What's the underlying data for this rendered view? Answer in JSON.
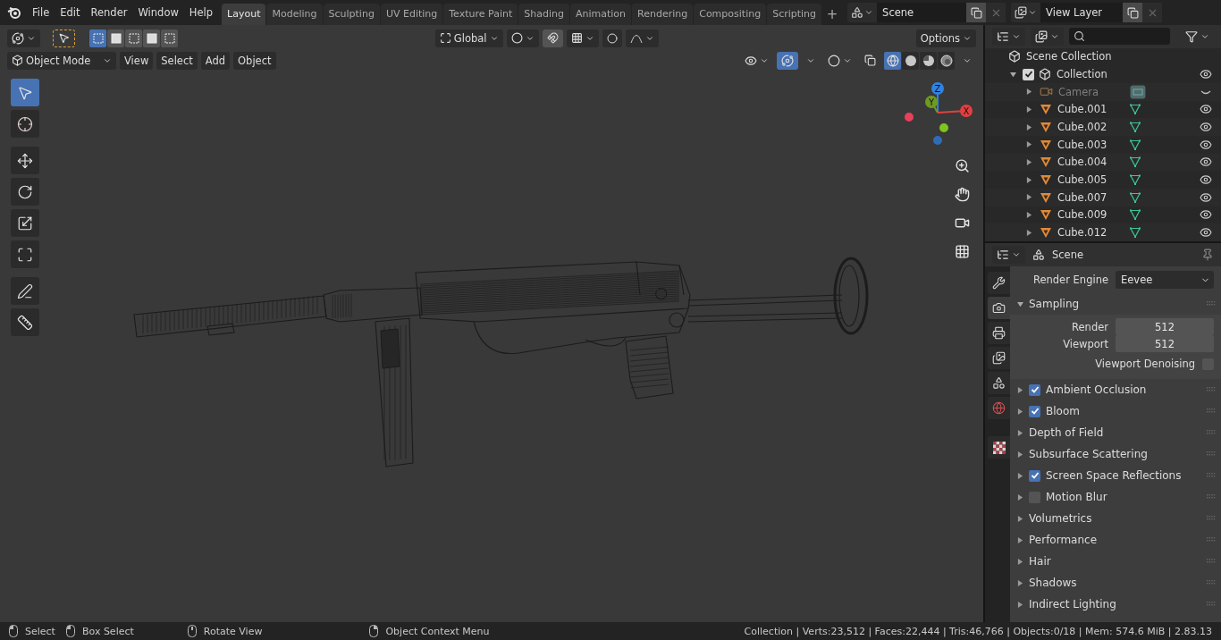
{
  "menu": [
    "File",
    "Edit",
    "Render",
    "Window",
    "Help"
  ],
  "workspaces": [
    {
      "label": "Layout",
      "selected": true
    },
    {
      "label": "Modeling",
      "selected": false
    },
    {
      "label": "Sculpting",
      "selected": false
    },
    {
      "label": "UV Editing",
      "selected": false
    },
    {
      "label": "Texture Paint",
      "selected": false
    },
    {
      "label": "Shading",
      "selected": false
    },
    {
      "label": "Animation",
      "selected": false
    },
    {
      "label": "Rendering",
      "selected": false
    },
    {
      "label": "Compositing",
      "selected": false
    },
    {
      "label": "Scripting",
      "selected": false
    }
  ],
  "add_workspace": "+",
  "scene": {
    "value": "Scene"
  },
  "view_layer": {
    "value": "View Layer"
  },
  "tool_header": {
    "selection_modes": [
      {
        "selected": true
      },
      {
        "selected": false
      },
      {
        "selected": false
      },
      {
        "selected": false
      },
      {
        "selected": false
      }
    ],
    "orientation": "Global",
    "options": "Options"
  },
  "viewport_header": {
    "mode": "Object Mode",
    "menus": [
      "View",
      "Select",
      "Add",
      "Object"
    ],
    "gizmos_on": true,
    "shading": [
      {
        "kind": "wireframe",
        "selected": true
      },
      {
        "kind": "solid",
        "selected": false
      },
      {
        "kind": "material",
        "selected": false
      },
      {
        "kind": "rendered",
        "selected": false
      }
    ]
  },
  "tools": [
    {
      "kind": "select",
      "selected": true
    },
    {
      "kind": "cursor",
      "selected": false
    },
    {
      "kind": "move",
      "selected": false
    },
    {
      "kind": "rotate",
      "selected": false
    },
    {
      "kind": "scale",
      "selected": false
    },
    {
      "kind": "transform",
      "selected": false
    },
    {
      "kind": "annotate",
      "selected": false
    },
    {
      "kind": "measure",
      "selected": false
    }
  ],
  "gizmo": {
    "axes": [
      {
        "label": "Z",
        "color": "#2f83e3"
      },
      {
        "label": "Y",
        "color": "#6f9a22"
      },
      {
        "label": "X",
        "color": "#e2403f"
      }
    ],
    "negatives": [
      {
        "color": "#e8405c"
      },
      {
        "color": "#7dc51e"
      },
      {
        "color": "#2f6cb5"
      }
    ]
  },
  "outliner": {
    "root": "Scene Collection",
    "items": [
      {
        "label": "Collection",
        "kind": "collection",
        "checked": true,
        "visible": true,
        "expanded": true,
        "children": [
          {
            "label": "Camera",
            "kind": "camera",
            "visible": false
          },
          {
            "label": "Cube.001",
            "kind": "mesh",
            "visible": true
          },
          {
            "label": "Cube.002",
            "kind": "mesh",
            "visible": true
          },
          {
            "label": "Cube.003",
            "kind": "mesh",
            "visible": true
          },
          {
            "label": "Cube.004",
            "kind": "mesh",
            "visible": true
          },
          {
            "label": "Cube.005",
            "kind": "mesh",
            "visible": true
          },
          {
            "label": "Cube.007",
            "kind": "mesh",
            "visible": true
          },
          {
            "label": "Cube.009",
            "kind": "mesh",
            "visible": true
          },
          {
            "label": "Cube.012",
            "kind": "mesh",
            "visible": true
          }
        ]
      }
    ]
  },
  "properties": {
    "context": "Scene",
    "tabs": [
      {
        "kind": "tool",
        "selected": false
      },
      {
        "kind": "render",
        "selected": true
      },
      {
        "kind": "output",
        "selected": false
      },
      {
        "kind": "view_layer",
        "selected": false
      },
      {
        "kind": "scene",
        "selected": false
      },
      {
        "kind": "world",
        "selected": false
      },
      {
        "kind": "texture",
        "selected": false
      }
    ],
    "render_engine": {
      "label": "Render Engine",
      "value": "Eevee"
    },
    "sampling": {
      "title": "Sampling",
      "expanded": true,
      "fields": [
        {
          "label": "Render",
          "value": "512"
        },
        {
          "label": "Viewport",
          "value": "512"
        }
      ],
      "denoising": {
        "label": "Viewport Denoising",
        "checked": false
      }
    },
    "panels": [
      {
        "title": "Ambient Occlusion",
        "kind": "toggle",
        "checked": true
      },
      {
        "title": "Bloom",
        "kind": "toggle",
        "checked": true
      },
      {
        "title": "Depth of Field",
        "kind": "plain"
      },
      {
        "title": "Subsurface Scattering",
        "kind": "plain"
      },
      {
        "title": "Screen Space Reflections",
        "kind": "toggle",
        "checked": true
      },
      {
        "title": "Motion Blur",
        "kind": "toggle",
        "checked": false
      },
      {
        "title": "Volumetrics",
        "kind": "plain"
      },
      {
        "title": "Performance",
        "kind": "plain"
      },
      {
        "title": "Hair",
        "kind": "plain"
      },
      {
        "title": "Shadows",
        "kind": "plain"
      },
      {
        "title": "Indirect Lighting",
        "kind": "plain"
      }
    ]
  },
  "status_bar": {
    "hints": [
      {
        "kind": "left",
        "label": "Select"
      },
      {
        "kind": "left",
        "label": "Box Select"
      },
      {
        "kind": "middle",
        "label": "Rotate View"
      },
      {
        "kind": "right",
        "label": "Object Context Menu"
      }
    ],
    "stats": "Collection | Verts:23,512 | Faces:22,444 | Tris:46,766 | Objects:0/18 | Mem: 574.6 MiB | 2.83.13"
  }
}
